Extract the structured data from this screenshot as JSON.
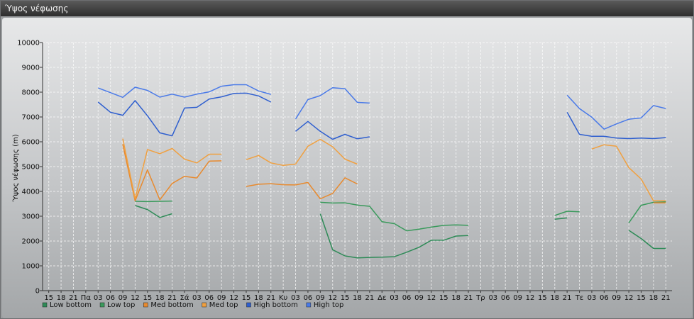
{
  "window": {
    "title": "Ύψος νέφωσης"
  },
  "chart_data": {
    "type": "line",
    "ylabel": "Ύψος νέφωσης (m)",
    "ylim": [
      0,
      10000
    ],
    "yticks": [
      0,
      1000,
      2000,
      3000,
      4000,
      5000,
      6000,
      7000,
      8000,
      9000,
      10000
    ],
    "grid": true,
    "legend_position": "bottom-left",
    "categories": [
      "15",
      "18",
      "21",
      "Πα",
      "03",
      "06",
      "09",
      "12",
      "15",
      "18",
      "21",
      "Σά",
      "03",
      "06",
      "09",
      "12",
      "15",
      "18",
      "21",
      "Κυ",
      "03",
      "06",
      "09",
      "12",
      "15",
      "18",
      "21",
      "Δε",
      "03",
      "06",
      "09",
      "12",
      "15",
      "18",
      "21",
      "Τρ",
      "03",
      "06",
      "09",
      "12",
      "15",
      "18",
      "21",
      "Τε",
      "03",
      "06",
      "09",
      "12",
      "15",
      "18",
      "21"
    ],
    "series": [
      {
        "name": "Low bottom",
        "color": "#2e8b57",
        "values": [
          null,
          null,
          null,
          null,
          null,
          null,
          null,
          3430,
          3270,
          2950,
          3100,
          null,
          null,
          null,
          null,
          null,
          null,
          null,
          null,
          null,
          null,
          null,
          3100,
          1650,
          1400,
          1320,
          1340,
          1350,
          1370,
          1550,
          1750,
          2030,
          2030,
          2200,
          2220,
          null,
          null,
          null,
          null,
          null,
          null,
          2880,
          2930,
          null,
          null,
          null,
          null,
          2430,
          2100,
          1700,
          1700
        ]
      },
      {
        "name": "Low top",
        "color": "#3a9a5c",
        "values": [
          null,
          null,
          null,
          null,
          null,
          null,
          null,
          3600,
          3590,
          3600,
          3610,
          null,
          null,
          null,
          null,
          null,
          null,
          null,
          null,
          null,
          null,
          null,
          3560,
          3530,
          3540,
          3450,
          3400,
          2780,
          2700,
          2410,
          2480,
          2560,
          2630,
          2650,
          2630,
          null,
          null,
          null,
          null,
          null,
          null,
          3030,
          3200,
          3180,
          null,
          null,
          null,
          2730,
          3440,
          3560,
          3580
        ]
      },
      {
        "name": "Med bottom",
        "color": "#e88a2e",
        "values": [
          null,
          null,
          null,
          null,
          null,
          null,
          5900,
          3620,
          4870,
          3660,
          4320,
          4610,
          4540,
          5220,
          5230,
          null,
          4200,
          4290,
          4310,
          4270,
          4260,
          4360,
          3700,
          3920,
          4550,
          4300,
          null,
          null,
          null,
          null,
          null,
          null,
          null,
          null,
          null,
          null,
          null,
          null,
          null,
          null,
          null,
          null,
          null,
          null,
          null,
          null,
          null,
          null,
          null,
          3540,
          3540
        ]
      },
      {
        "name": "Med top",
        "color": "#f0a040",
        "values": [
          null,
          null,
          null,
          null,
          null,
          null,
          6130,
          3700,
          5690,
          5520,
          5730,
          5300,
          5150,
          5500,
          5500,
          null,
          5280,
          5450,
          5150,
          5050,
          5100,
          5820,
          6100,
          5800,
          5300,
          5100,
          null,
          null,
          null,
          null,
          null,
          null,
          null,
          null,
          null,
          null,
          null,
          null,
          null,
          null,
          null,
          null,
          null,
          null,
          5710,
          5880,
          5820,
          4960,
          4500,
          3620,
          3620
        ]
      },
      {
        "name": "High bottom",
        "color": "#2f5fcf",
        "values": [
          null,
          null,
          null,
          null,
          7600,
          7190,
          7070,
          7660,
          7050,
          6360,
          6240,
          7360,
          7390,
          7720,
          7810,
          7950,
          7960,
          7850,
          7600,
          null,
          6420,
          6820,
          6420,
          6100,
          6300,
          6120,
          6200,
          null,
          null,
          null,
          null,
          null,
          null,
          null,
          null,
          null,
          null,
          null,
          null,
          null,
          null,
          null,
          7190,
          6300,
          6220,
          6220,
          6150,
          6130,
          6150,
          6130,
          6170
        ]
      },
      {
        "name": "High top",
        "color": "#4a7ae8",
        "values": [
          null,
          null,
          null,
          null,
          8170,
          7980,
          7790,
          8200,
          8070,
          7800,
          7920,
          7800,
          7920,
          8010,
          8240,
          8300,
          8300,
          8050,
          7910,
          null,
          6920,
          7700,
          7860,
          8180,
          8140,
          7590,
          7560,
          null,
          null,
          null,
          null,
          null,
          null,
          null,
          null,
          null,
          null,
          null,
          null,
          null,
          null,
          null,
          7880,
          7340,
          6990,
          6510,
          6720,
          6910,
          6960,
          7460,
          7340
        ]
      }
    ]
  }
}
